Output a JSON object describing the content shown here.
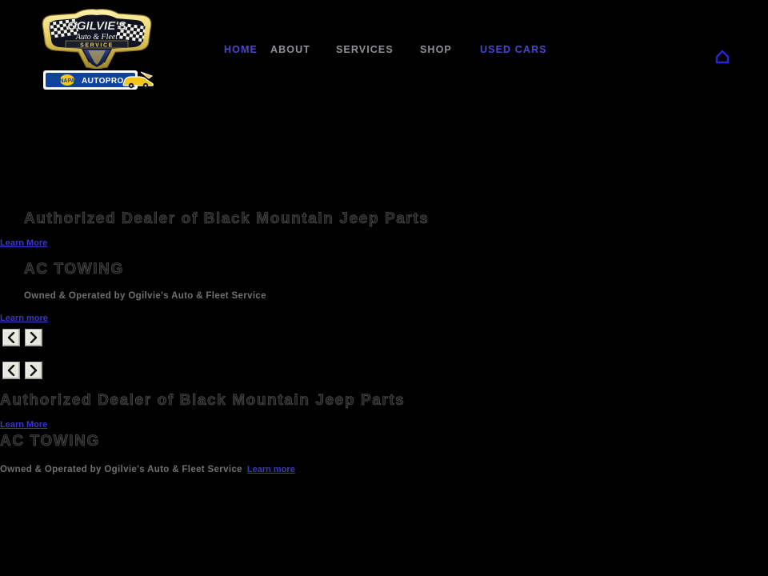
{
  "site": {
    "background_color": "#000000",
    "logo": {
      "brand_name": "OGILVIE'S",
      "tagline": "Auto & Fleet",
      "sub_tagline": "SERVICE",
      "alt": "Ogilvie's Auto & Fleet Service"
    },
    "partner_banner": {
      "brand": "NAPA",
      "program": "AUTOPRO",
      "alt": "NAPA AUTOPRO"
    }
  },
  "nav": {
    "items": [
      {
        "label": "HOME",
        "state": "active"
      },
      {
        "label": "ABOUT",
        "state": "muted"
      },
      {
        "label": "SERVICES",
        "state": "muted"
      },
      {
        "label": "SHOP",
        "state": "muted"
      },
      {
        "label": "USED CARS",
        "state": "link"
      }
    ],
    "home_icon": "home-icon"
  },
  "slides": [
    {
      "title": "Authorized Dealer of Black Mountain Jeep Parts",
      "link_label": "Learn More"
    },
    {
      "title": "AC TOWING",
      "subtitle": "Owned & Operated by Ogilvie's Auto & Fleet Service",
      "link_label": "Learn more"
    },
    {
      "title": "Authorized Dealer of Black Mountain Jeep Parts",
      "link_label": "Learn More"
    },
    {
      "title": "AC TOWING",
      "subtitle": "Owned & Operated by Ogilvie's Auto & Fleet Service",
      "link_label": "Learn more"
    }
  ],
  "carousels": [
    {
      "prev_icon": "chevron-left-icon",
      "next_icon": "chevron-right-icon"
    },
    {
      "prev_icon": "chevron-left-icon",
      "next_icon": "chevron-right-icon"
    }
  ],
  "colors": {
    "link": "#3b38c4",
    "nav_active": "#4a47cf",
    "nav_muted": "#8f9196",
    "logo_gold": "#f4e07a",
    "napa_blue": "#10439b",
    "button_face": "#e8e8e0"
  }
}
